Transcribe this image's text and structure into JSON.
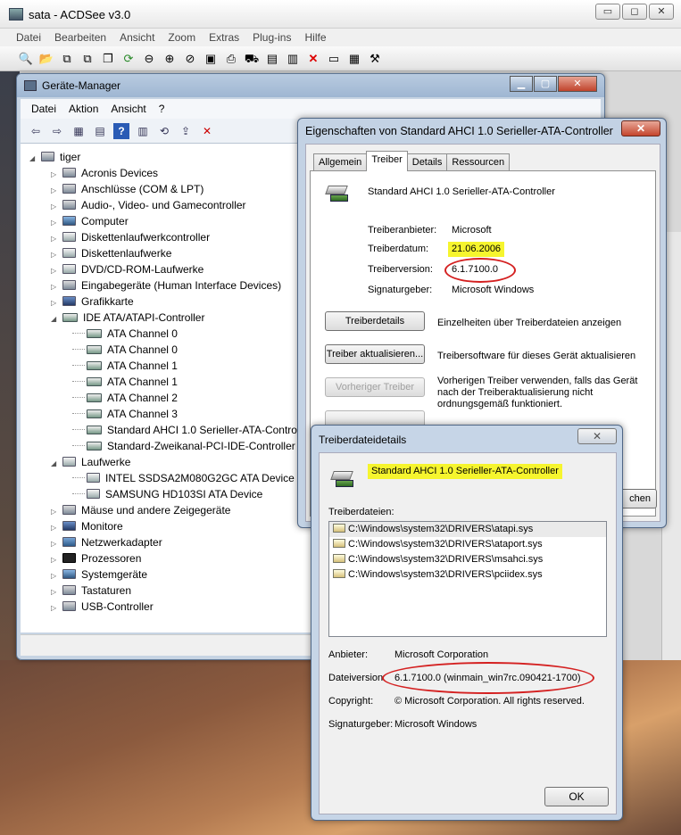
{
  "acdsee": {
    "title": "sata - ACDSee v3.0",
    "caption_buttons": [
      "▭",
      "◻",
      "✕"
    ],
    "menu": [
      "Datei",
      "Bearbeiten",
      "Ansicht",
      "Zoom",
      "Extras",
      "Plug-ins",
      "Hilfe"
    ],
    "toolbar_icons": [
      "browse-icon",
      "open-icon",
      "prev-icon",
      "next-icon",
      "copy-icon",
      "refresh-icon",
      "zoom-out-icon",
      "zoom-in-icon",
      "zoom-fit-icon",
      "slideshow-icon",
      "print-icon",
      "acquire-icon",
      "clipboard-icon",
      "paste-icon",
      "delete-icon",
      "rename-icon",
      "properties-icon",
      "tools-icon"
    ]
  },
  "device_manager": {
    "title": "Geräte-Manager",
    "menu": [
      "Datei",
      "Aktion",
      "Ansicht",
      "?"
    ],
    "root": "tiger",
    "tree": [
      {
        "label": "Acronis Devices",
        "icon": "pc",
        "level": 1,
        "exp": "▷"
      },
      {
        "label": "Anschlüsse (COM & LPT)",
        "icon": "pc",
        "level": 1,
        "exp": "▷"
      },
      {
        "label": "Audio-, Video- und Gamecontroller",
        "icon": "pc",
        "level": 1,
        "exp": "▷"
      },
      {
        "label": "Computer",
        "icon": "comp",
        "level": 1,
        "exp": "▷"
      },
      {
        "label": "Diskettenlaufwerkcontroller",
        "icon": "disk",
        "level": 1,
        "exp": "▷"
      },
      {
        "label": "Diskettenlaufwerke",
        "icon": "disk",
        "level": 1,
        "exp": "▷"
      },
      {
        "label": "DVD/CD-ROM-Laufwerke",
        "icon": "disk",
        "level": 1,
        "exp": "▷"
      },
      {
        "label": "Eingabegeräte (Human Interface Devices)",
        "icon": "pc",
        "level": 1,
        "exp": "▷"
      },
      {
        "label": "Grafikkarte",
        "icon": "mon",
        "level": 1,
        "exp": "▷"
      },
      {
        "label": "IDE ATA/ATAPI-Controller",
        "icon": "chan",
        "level": 1,
        "exp": "◢"
      },
      {
        "label": "ATA Channel 0",
        "icon": "chan",
        "level": 2,
        "exp": ""
      },
      {
        "label": "ATA Channel 0",
        "icon": "chan",
        "level": 2,
        "exp": ""
      },
      {
        "label": "ATA Channel 1",
        "icon": "chan",
        "level": 2,
        "exp": ""
      },
      {
        "label": "ATA Channel 1",
        "icon": "chan",
        "level": 2,
        "exp": ""
      },
      {
        "label": "ATA Channel 2",
        "icon": "chan",
        "level": 2,
        "exp": ""
      },
      {
        "label": "ATA Channel 3",
        "icon": "chan",
        "level": 2,
        "exp": ""
      },
      {
        "label": "Standard AHCI 1.0 Serieller-ATA-Controller",
        "icon": "chan",
        "level": 2,
        "exp": ""
      },
      {
        "label": "Standard-Zweikanal-PCI-IDE-Controller",
        "icon": "chan",
        "level": 2,
        "exp": ""
      },
      {
        "label": "Laufwerke",
        "icon": "disk",
        "level": 1,
        "exp": "◢"
      },
      {
        "label": "INTEL SSDSA2M080G2GC ATA Device",
        "icon": "disk",
        "level": 2,
        "exp": ""
      },
      {
        "label": "SAMSUNG HD103SI ATA Device",
        "icon": "disk",
        "level": 2,
        "exp": ""
      },
      {
        "label": "Mäuse und andere Zeigegeräte",
        "icon": "pc",
        "level": 1,
        "exp": "▷"
      },
      {
        "label": "Monitore",
        "icon": "mon",
        "level": 1,
        "exp": "▷"
      },
      {
        "label": "Netzwerkadapter",
        "icon": "net",
        "level": 1,
        "exp": "▷"
      },
      {
        "label": "Prozessoren",
        "icon": "cpu",
        "level": 1,
        "exp": "▷"
      },
      {
        "label": "Systemgeräte",
        "icon": "comp",
        "level": 1,
        "exp": "▷"
      },
      {
        "label": "Tastaturen",
        "icon": "pc",
        "level": 1,
        "exp": "▷"
      },
      {
        "label": "USB-Controller",
        "icon": "pc",
        "level": 1,
        "exp": "▷"
      }
    ]
  },
  "properties": {
    "title": "Eigenschaften von Standard AHCI 1.0 Serieller-ATA-Controller",
    "close": "✕",
    "tabs": [
      "Allgemein",
      "Treiber",
      "Details",
      "Ressourcen"
    ],
    "active_tab": "Treiber",
    "device_name": "Standard AHCI 1.0 Serieller-ATA-Controller",
    "fields": {
      "vendor_label": "Treiberanbieter:",
      "vendor_value": "Microsoft",
      "date_label": "Treiberdatum:",
      "date_value": "21.06.2006",
      "version_label": "Treiberversion:",
      "version_value": "6.1.7100.0",
      "signer_label": "Signaturgeber:",
      "signer_value": "Microsoft Windows"
    },
    "buttons": {
      "details": "Treiberdetails",
      "details_desc": "Einzelheiten über Treiberdateien anzeigen",
      "update": "Treiber aktualisieren...",
      "update_desc": "Treibersoftware für dieses Gerät aktualisieren",
      "rollback": "Vorheriger Treiber",
      "rollback_desc": "Vorherigen Treiber verwenden, falls das Gerät nach der Treiberaktualisierung nicht ordnungsgemäß funktioniert.",
      "partial_cancel": "chen"
    },
    "highlight_color": "#f6f52e",
    "circle_color": "#d42020"
  },
  "driver_files": {
    "title": "Treiberdateidetails",
    "close": "✕",
    "device_name": "Standard AHCI 1.0 Serieller-ATA-Controller",
    "files_label": "Treiberdateien:",
    "files": [
      "C:\\Windows\\system32\\DRIVERS\\atapi.sys",
      "C:\\Windows\\system32\\DRIVERS\\ataport.sys",
      "C:\\Windows\\system32\\DRIVERS\\msahci.sys",
      "C:\\Windows\\system32\\DRIVERS\\pciidex.sys"
    ],
    "provider_label": "Anbieter:",
    "provider_value": "Microsoft Corporation",
    "fileversion_label": "Dateiversion:",
    "fileversion_value": "6.1.7100.0 (winmain_win7rc.090421-1700)",
    "copyright_label": "Copyright:",
    "copyright_value": "© Microsoft Corporation. All rights reserved.",
    "signer_label": "Signaturgeber:",
    "signer_value": "Microsoft Windows",
    "ok": "OK"
  }
}
